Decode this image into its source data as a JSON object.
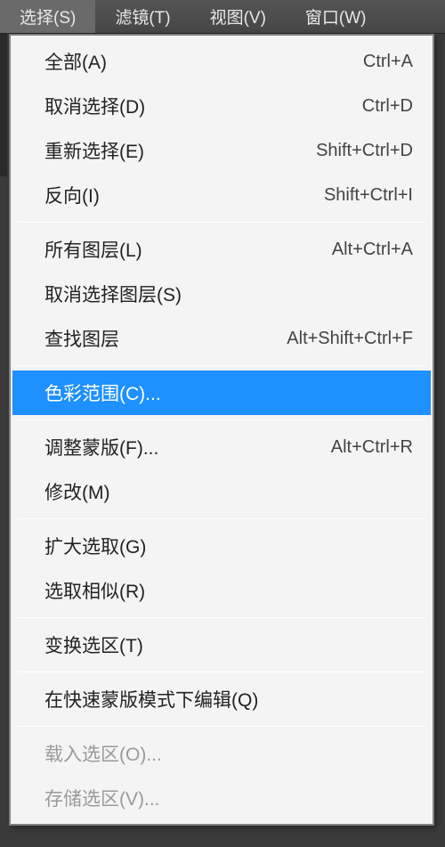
{
  "menubar": {
    "items": [
      {
        "label": "选择(S)",
        "active": true
      },
      {
        "label": "滤镜(T)",
        "active": false
      },
      {
        "label": "视图(V)",
        "active": false
      },
      {
        "label": "窗口(W)",
        "active": false
      }
    ]
  },
  "dropdown": {
    "groups": [
      [
        {
          "label": "全部(A)",
          "shortcut": "Ctrl+A",
          "state": "normal",
          "name": "menu-select-all"
        },
        {
          "label": "取消选择(D)",
          "shortcut": "Ctrl+D",
          "state": "normal",
          "name": "menu-deselect"
        },
        {
          "label": "重新选择(E)",
          "shortcut": "Shift+Ctrl+D",
          "state": "normal",
          "name": "menu-reselect"
        },
        {
          "label": "反向(I)",
          "shortcut": "Shift+Ctrl+I",
          "state": "normal",
          "name": "menu-inverse"
        }
      ],
      [
        {
          "label": "所有图层(L)",
          "shortcut": "Alt+Ctrl+A",
          "state": "normal",
          "name": "menu-all-layers"
        },
        {
          "label": "取消选择图层(S)",
          "shortcut": "",
          "state": "normal",
          "name": "menu-deselect-layers"
        },
        {
          "label": "查找图层",
          "shortcut": "Alt+Shift+Ctrl+F",
          "state": "normal",
          "name": "menu-find-layers"
        }
      ],
      [
        {
          "label": "色彩范围(C)...",
          "shortcut": "",
          "state": "highlighted",
          "name": "menu-color-range"
        }
      ],
      [
        {
          "label": "调整蒙版(F)...",
          "shortcut": "Alt+Ctrl+R",
          "state": "normal",
          "name": "menu-refine-mask"
        },
        {
          "label": "修改(M)",
          "shortcut": "",
          "state": "normal",
          "name": "menu-modify"
        }
      ],
      [
        {
          "label": "扩大选取(G)",
          "shortcut": "",
          "state": "normal",
          "name": "menu-grow"
        },
        {
          "label": "选取相似(R)",
          "shortcut": "",
          "state": "normal",
          "name": "menu-similar"
        }
      ],
      [
        {
          "label": "变换选区(T)",
          "shortcut": "",
          "state": "normal",
          "name": "menu-transform-selection"
        }
      ],
      [
        {
          "label": "在快速蒙版模式下编辑(Q)",
          "shortcut": "",
          "state": "normal",
          "name": "menu-quick-mask"
        }
      ],
      [
        {
          "label": "载入选区(O)...",
          "shortcut": "",
          "state": "disabled",
          "name": "menu-load-selection"
        },
        {
          "label": "存储选区(V)...",
          "shortcut": "",
          "state": "disabled",
          "name": "menu-save-selection"
        }
      ]
    ]
  }
}
